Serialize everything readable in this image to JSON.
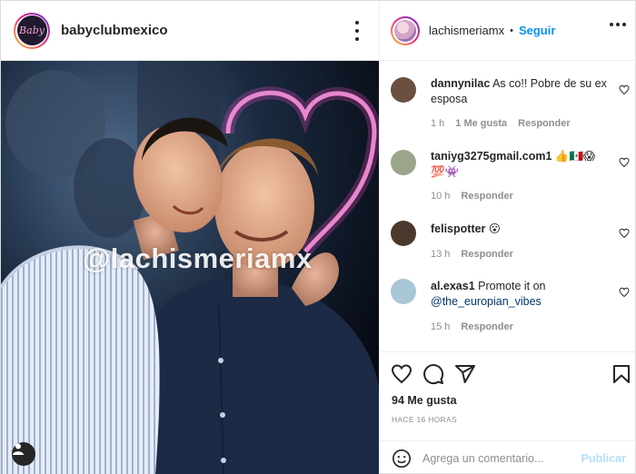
{
  "post": {
    "author": "babyclubmexico",
    "author_logo_text": "Baby",
    "watermark": "@lachismeriamx"
  },
  "side": {
    "username": "lachismeriamx",
    "separator": "•",
    "follow_label": "Seguir"
  },
  "comments": [
    {
      "user": "dannynilac",
      "text": "As co!! Pobre de su ex esposa",
      "time": "1 h",
      "likes": "1 Me gusta",
      "reply": "Responder",
      "avatar_color": "#6b4f3f"
    },
    {
      "user": "taniyg3275gmail.com1",
      "text": "👍🇲🇽😱💯👾",
      "time": "10 h",
      "reply": "Responder",
      "avatar_color": "#9aa58a"
    },
    {
      "user": "felispotter",
      "text": "😮",
      "time": "13 h",
      "reply": "Responder",
      "avatar_color": "#4a3a2e"
    },
    {
      "user": "al.exas1",
      "text": "Promote it on",
      "mention": "@the_europian_vibes",
      "time": "15 h",
      "reply": "Responder",
      "avatar_color": "#a9c6d6"
    }
  ],
  "actions": {
    "likes": "94 Me gusta",
    "posted_ago": "HACE 16 HORAS",
    "comment_placeholder": "Agrega un comentario...",
    "publish_label": "Publicar"
  },
  "icons": {
    "more": "more-vertical-icon",
    "heart": "heart-icon",
    "comment": "comment-icon",
    "share": "send-icon",
    "save": "bookmark-icon",
    "emoji": "smiley-icon",
    "tag": "user-tag-icon"
  },
  "colors": {
    "follow": "#0095f6",
    "publish_disabled": "#b2dffc",
    "neon": "#f7a8e0"
  }
}
